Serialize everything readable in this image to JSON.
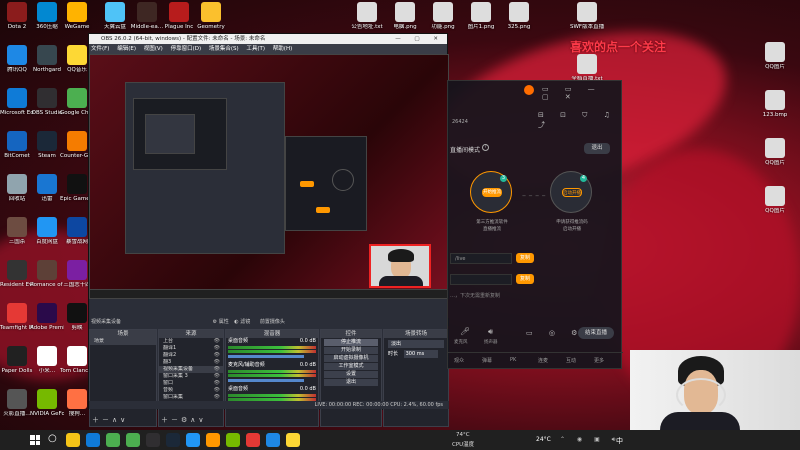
{
  "desktop": {
    "col1": [
      {
        "label": "Dota 2",
        "color": "#8b1c1c"
      },
      {
        "label": "腾讯QQ",
        "color": "#1e88e5"
      },
      {
        "label": "Microsoft Edge",
        "color": "#0f7bd7"
      },
      {
        "label": "BitComet",
        "color": "#1565c0"
      },
      {
        "label": "回收站",
        "color": "#90a4ae"
      },
      {
        "label": "三国杀",
        "color": "#6d4c41"
      },
      {
        "label": "Resident Evil Village",
        "color": "#333333"
      },
      {
        "label": "Teamfight Manager",
        "color": "#e53935"
      },
      {
        "label": "Paper Dolls",
        "color": "#212121"
      },
      {
        "label": "火影直播…",
        "color": "#555555"
      }
    ],
    "col2": [
      {
        "label": "360压缩",
        "color": "#0288d1"
      },
      {
        "label": "Northgard",
        "color": "#37474f"
      },
      {
        "label": "OBS Studio",
        "color": "#302e31"
      },
      {
        "label": "Steam",
        "color": "#1b2838"
      },
      {
        "label": "迅雷",
        "color": "#1976d2"
      },
      {
        "label": "百度网盘",
        "color": "#2196f3"
      },
      {
        "label": "Romance of the Three",
        "color": "#5d4037"
      },
      {
        "label": "Adobe Premiere",
        "color": "#2a0a4a"
      },
      {
        "label": "小米…",
        "color": "#ffffff"
      },
      {
        "label": "NVIDIA GeForce",
        "color": "#76b900"
      }
    ],
    "col3": [
      {
        "label": "WeGame",
        "color": "#ffb300"
      },
      {
        "label": "QQ音乐",
        "color": "#fdd835"
      },
      {
        "label": "Google Chrome",
        "color": "#4caf50"
      },
      {
        "label": "Counter-Global",
        "color": "#f57c00"
      },
      {
        "label": "Epic Games Launcher",
        "color": "#111111"
      },
      {
        "label": "暴雪战网",
        "color": "#0d47a1"
      },
      {
        "label": "三国志十四",
        "color": "#7b1fa2"
      },
      {
        "label": "剪映",
        "color": "#111111"
      },
      {
        "label": "Tom Clancy's",
        "color": "#ffffff"
      },
      {
        "label": "搜狗…",
        "color": "#ff7043"
      }
    ],
    "top_row": [
      {
        "label": "天翼云盘",
        "color": "#4fc3f7"
      },
      {
        "label": "Middle-ea…",
        "color": "#3e2723"
      },
      {
        "label": "Plague Inc",
        "color": "#b71c1c"
      },
      {
        "label": "Geometry",
        "color": "#fbc02d"
      }
    ],
    "top_files": [
      {
        "label": "公告地址.txt"
      },
      {
        "label": "电脑.png"
      },
      {
        "label": "功能.png"
      },
      {
        "label": "图片1.png"
      },
      {
        "label": "325.png"
      }
    ],
    "right_files": [
      {
        "label": "SWF版本直播.tfmbr"
      },
      {
        "label": "全档直播.txt"
      },
      {
        "label": "QQ图片"
      },
      {
        "label": "123.bmp"
      },
      {
        "label": "QQ图片"
      },
      {
        "label": "QQ图片"
      }
    ],
    "overlay_text": "喜欢的点一个关注"
  },
  "obs": {
    "title": "OBS 26.0.2 (64-bit, windows) - 配置文件: 未命名 - 场景: 未命名",
    "menu": [
      "文件(F)",
      "编辑(E)",
      "视图(V)",
      "停靠窗口(D)",
      "场景集合(S)",
      "工具(T)",
      "帮助(H)"
    ],
    "source_bar": {
      "current": "视频采集设备",
      "props": "属性",
      "filters": "滤镜",
      "device": "前置摄像头"
    },
    "docks": {
      "scenes": {
        "title": "场景",
        "items": [
          "场景"
        ]
      },
      "sources": {
        "title": "来源",
        "items": [
          "上台",
          "翻译1",
          "翻译2",
          "翻3",
          "视频采集设备",
          "窗口采集 3",
          "窗口",
          "音频",
          "窗口采集",
          "游戏采集"
        ]
      },
      "mixer": {
        "title": "混音器",
        "tracks": [
          {
            "name": "桌面音频",
            "db": "0.0 dB"
          },
          {
            "name": "麦克风/辅助音频",
            "db": "0.0 dB"
          },
          {
            "name": "桌面音频",
            "db": "0.0 dB"
          }
        ]
      },
      "controls": {
        "title": "控件",
        "buttons": [
          "停止推流",
          "开始录制",
          "启动虚拟摄像机",
          "工作室模式",
          "设置",
          "退出"
        ]
      },
      "transitions": {
        "title": "场景转场",
        "type": "淡出",
        "duration_label": "时长",
        "duration": "300 ms"
      }
    },
    "status": "LIVE: 00:00:00   REC: 00:00:00   CPU: 2.4%, 60.00 fps"
  },
  "stream_app": {
    "id_suffix": "26424",
    "mode_label": "直播间模式",
    "exit": "退出",
    "left_circle": {
      "badge": "3",
      "label": "开始推流",
      "caption1": "第三方推流软件",
      "caption2": "直播推流"
    },
    "right_circle": {
      "badge": "4",
      "label": "启动开播",
      "caption1": "申请获得推流码",
      "caption2": "启动开播"
    },
    "url_field": "/live",
    "copy1": "复制",
    "copy2": "复制",
    "hint": "…，下次无需重新复制",
    "bottom": {
      "mic": "麦克风",
      "speaker": "扬声器",
      "end_btn": "结束直播"
    },
    "footer": [
      "观众",
      "弹幕",
      "PK",
      "连麦",
      "互动",
      "更多"
    ]
  },
  "taskbar": {
    "weather_temp": "24°C",
    "weather_desc": "CPU温度",
    "tray_temp": "74°C",
    "lang": "中"
  }
}
